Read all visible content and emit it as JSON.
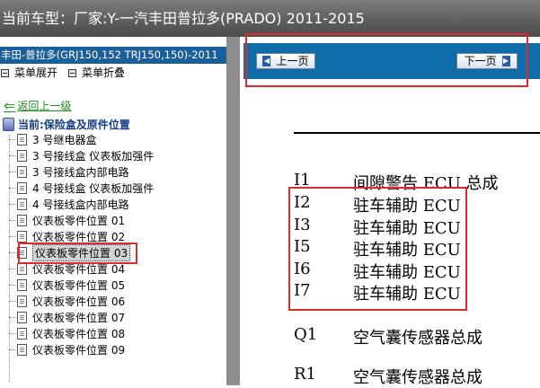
{
  "title": "当前车型：厂家:Y-一汽丰田普拉多(PRADO) 2011-2015",
  "left_panel": {
    "vehicle": "丰田-普拉多(GRJ150,152 TRJ150,150)-2011",
    "expand_label": "菜单展开",
    "collapse_label": "菜单折叠",
    "back_label": "返回上一级",
    "current_label": "当前:保险盒及原件位置",
    "items": [
      {
        "label": "3 号继电器盒"
      },
      {
        "label": "3 号接线盒 仪表板加强件"
      },
      {
        "label": "3 号接线盒内部电路"
      },
      {
        "label": "4 号接线盒 仪表板加强件"
      },
      {
        "label": "4 号接线盒内部电路"
      },
      {
        "label": "仪表板零件位置 01"
      },
      {
        "label": "仪表板零件位置 02"
      },
      {
        "label": "仪表板零件位置 03"
      },
      {
        "label": "仪表板零件位置 04"
      },
      {
        "label": "仪表板零件位置 05"
      },
      {
        "label": "仪表板零件位置 06"
      },
      {
        "label": "仪表板零件位置 07"
      },
      {
        "label": "仪表板零件位置 08"
      },
      {
        "label": "仪表板零件位置 09"
      }
    ],
    "selected_index": 7
  },
  "nav": {
    "prev_label": "上一页",
    "next_label": "下一页"
  },
  "document": {
    "entries": [
      {
        "code": "I1",
        "desc": "间隙警告 ECU 总成"
      },
      {
        "code": "I2",
        "desc": "驻车辅助 ECU"
      },
      {
        "code": "I3",
        "desc": "驻车辅助 ECU"
      },
      {
        "code": "I5",
        "desc": "驻车辅助 ECU"
      },
      {
        "code": "I6",
        "desc": "驻车辅助 ECU"
      },
      {
        "code": "I7",
        "desc": "驻车辅助 ECU"
      },
      {
        "code": "Q1",
        "desc": "空气囊传感器总成"
      },
      {
        "code": "R1",
        "desc": "空气囊传感器总成"
      }
    ]
  },
  "colors": {
    "highlight_box": "#e02a2a",
    "nav_bar": "#0e6ca8",
    "vehicle_header": "#1a5f9a"
  }
}
